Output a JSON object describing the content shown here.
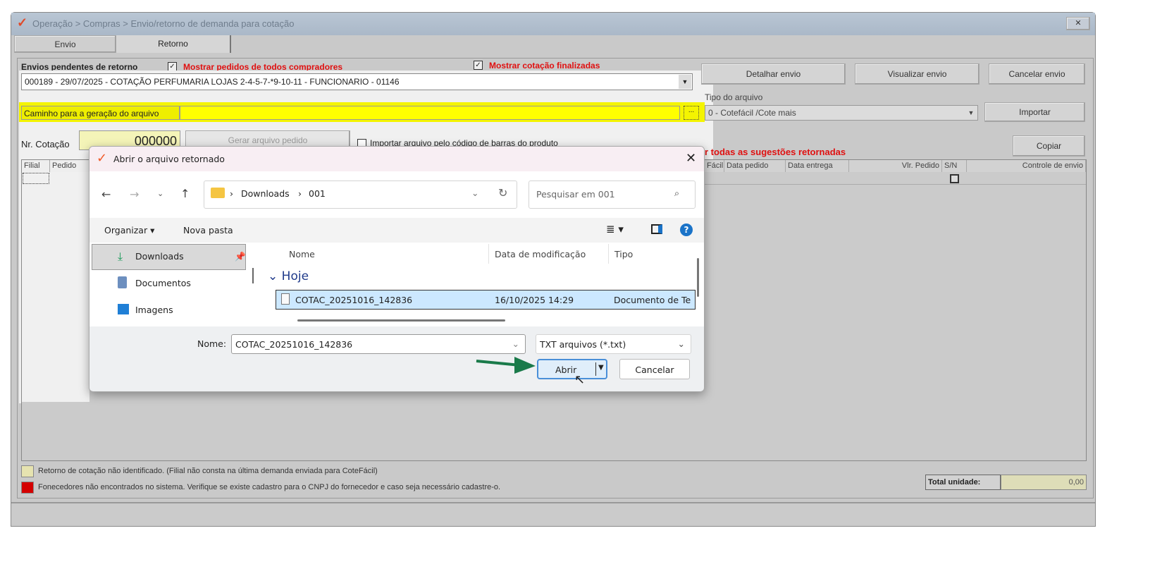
{
  "window": {
    "title": "Operação > Compras > Envio/retorno de demanda para cotação",
    "close_icon": "close-icon"
  },
  "tabs": [
    {
      "label": "Envio"
    },
    {
      "label": "Retorno"
    }
  ],
  "retorno": {
    "pending_label": "Envios pendentes de retorno",
    "show_all_buyers": {
      "label": "Mostrar pedidos de todos compradores",
      "checked": true
    },
    "show_finished": {
      "label": "Mostrar cotação finalizadas",
      "checked": true
    },
    "envio_select": "000189 - 29/07/2025 - COTAÇÃO PERFUMARIA LOJAS 2-4-5-7-*9-10-11 - FUNCIONARIO - 01146",
    "path_label": "Caminho para a geração do arquivo",
    "path_value": "",
    "browse_label": "...",
    "nr_cotacao_label": "Nr. Cotação",
    "nr_cotacao_value": "000000",
    "gerar_button": "Gerar arquivo pedido",
    "barcode_checkbox": {
      "label": "Importar arquivo pelo código de barras do produto",
      "checked": false
    },
    "detalhar_button": "Detalhar envio",
    "visualizar_button": "Visualizar envio",
    "cancelar_envio_button": "Cancelar envio",
    "tipo_arquivo_label": "Tipo do arquivo",
    "tipo_arquivo_value": "0 - Cotefácil /Cote mais",
    "importar_button": "Importar",
    "copiar_button": "Copiar",
    "sugestoes_label": "r todas as sugestões retornadas",
    "grid_columns_left": [
      "Filial",
      "Pedido"
    ],
    "grid_columns_right": [
      "Fácil",
      "Data pedido",
      "Data entrega",
      "Vlr. Pedido",
      "S/N",
      "Controle de envio"
    ],
    "legend": [
      {
        "color": "#e6e3b0",
        "text": "Retorno de cotação não identificado. (Filial não consta na última demanda enviada para CoteFácil)"
      },
      {
        "color": "#d40000",
        "text": "Fonecedores não encontrados no sistema. Verifique se existe cadastro para o CNPJ do fornecedor e caso seja necessário cadastre-o."
      }
    ],
    "total_label": "Total unidade:",
    "total_value": "0,00"
  },
  "dialog": {
    "title": "Abrir o arquivo retornado",
    "breadcrumb": [
      "Downloads",
      "001"
    ],
    "search_placeholder": "Pesquisar em 001",
    "organizar": "Organizar",
    "nova_pasta": "Nova pasta",
    "nav": [
      {
        "label": "Downloads",
        "selected": true
      },
      {
        "label": "Documentos"
      },
      {
        "label": "Imagens"
      }
    ],
    "columns": [
      "Nome",
      "Data de modificação",
      "Tipo"
    ],
    "group": "Hoje",
    "files": [
      {
        "name": "COTAC_20251016_142836",
        "date": "16/10/2025 14:29",
        "type": "Documento de Te"
      }
    ],
    "name_label": "Nome:",
    "name_value": "COTAC_20251016_142836",
    "filter": "TXT arquivos (*.txt)",
    "open_button": "Abrir",
    "cancel_button": "Cancelar"
  }
}
